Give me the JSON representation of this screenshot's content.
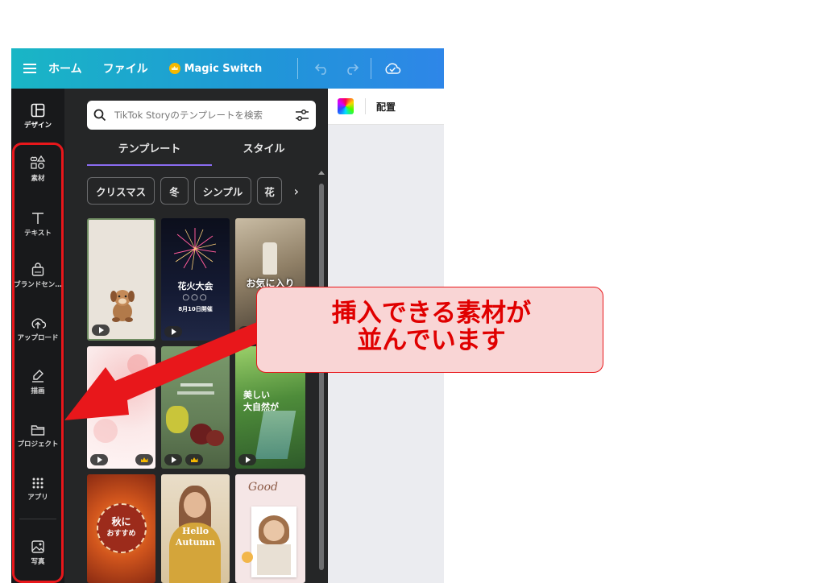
{
  "topbar": {
    "home_label": "ホーム",
    "file_label": "ファイル",
    "magic_switch_label": "Magic Switch"
  },
  "rail": {
    "items": [
      {
        "label": "デザイン",
        "icon": "layout-icon"
      },
      {
        "label": "素材",
        "icon": "elements-icon"
      },
      {
        "label": "テキスト",
        "icon": "text-icon"
      },
      {
        "label": "ブランドセン…",
        "icon": "brand-icon"
      },
      {
        "label": "アップロード",
        "icon": "upload-icon"
      },
      {
        "label": "描画",
        "icon": "draw-icon"
      },
      {
        "label": "プロジェクト",
        "icon": "folder-icon"
      },
      {
        "label": "アプリ",
        "icon": "apps-icon"
      },
      {
        "label": "写真",
        "icon": "photo-icon"
      }
    ]
  },
  "panel": {
    "search_placeholder": "TikTok Storyのテンプレートを検索",
    "tabs": [
      {
        "label": "テンプレート",
        "active": true
      },
      {
        "label": "スタイル",
        "active": false
      }
    ],
    "chips": [
      "クリスマス",
      "冬",
      "シンプル",
      "花"
    ],
    "thumbnails": {
      "t2_title": "花火大会",
      "t2_sub": "8月10日開催",
      "t3_title": "お気に入り",
      "t6_title1": "美しい",
      "t6_title2": "大自然が",
      "t7_title1": "秋に",
      "t7_title2": "おすすめ",
      "t8_title1": "Hello",
      "t8_title2": "Autumn",
      "t9_title": "Good"
    }
  },
  "canvas": {
    "toolbar_label": "配置"
  },
  "annotation": {
    "line1": "挿入できる素材が",
    "line2": "並んでいます",
    "color": "#e8171b"
  }
}
